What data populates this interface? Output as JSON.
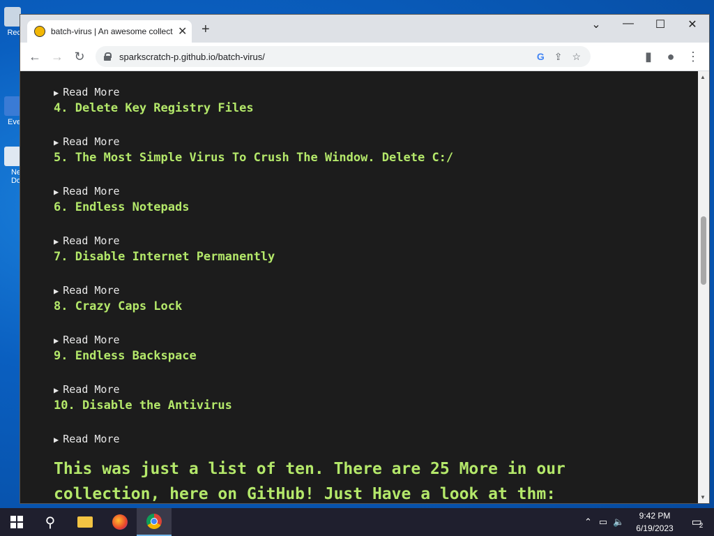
{
  "desktop": {
    "icons": [
      {
        "label": "Rec",
        "icon": "recycle-bin-icon"
      },
      {
        "label": "Eve",
        "icon": "app-shortcut-icon"
      },
      {
        "label": "Ne\nDo",
        "icon": "document-icon"
      }
    ]
  },
  "browser": {
    "tab": {
      "title": "batch-virus | An awesome collect",
      "favicon": "batch-virus-favicon"
    },
    "new_tab": "+",
    "url": "sparkscratch-p.github.io/batch-virus/",
    "window_controls": {
      "tab_search": "⌄",
      "minimize": "—",
      "maximize": "☐",
      "close": "✕"
    }
  },
  "page": {
    "items": [
      {
        "read_more": "Read More",
        "title": "4. Delete Key Registry Files"
      },
      {
        "read_more": "Read More",
        "title": "5. The Most Simple Virus To Crush The Window. Delete C:/"
      },
      {
        "read_more": "Read More",
        "title": "6. Endless Notepads"
      },
      {
        "read_more": "Read More",
        "title": "7. Disable Internet Permanently"
      },
      {
        "read_more": "Read More",
        "title": "8. Crazy Caps Lock"
      },
      {
        "read_more": "Read More",
        "title": "9. Endless Backspace"
      },
      {
        "read_more": "Read More",
        "title": "10. Disable the Antivirus"
      }
    ],
    "last_read_more": "Read More",
    "footer_text": "This was just a list of ten. There are 25 More in our collection, here on GitHub! Just Have a look at thm:"
  },
  "taskbar": {
    "apps": [
      "start-icon",
      "search-icon",
      "file-explorer-icon",
      "firefox-icon",
      "chrome-icon"
    ],
    "time": "9:42 PM",
    "date": "6/19/2023",
    "notification_count": "2"
  },
  "colors": {
    "page_bg": "#1c1c1c",
    "title_green": "#b4e86a",
    "read_more_text": "#e8e8e8"
  }
}
